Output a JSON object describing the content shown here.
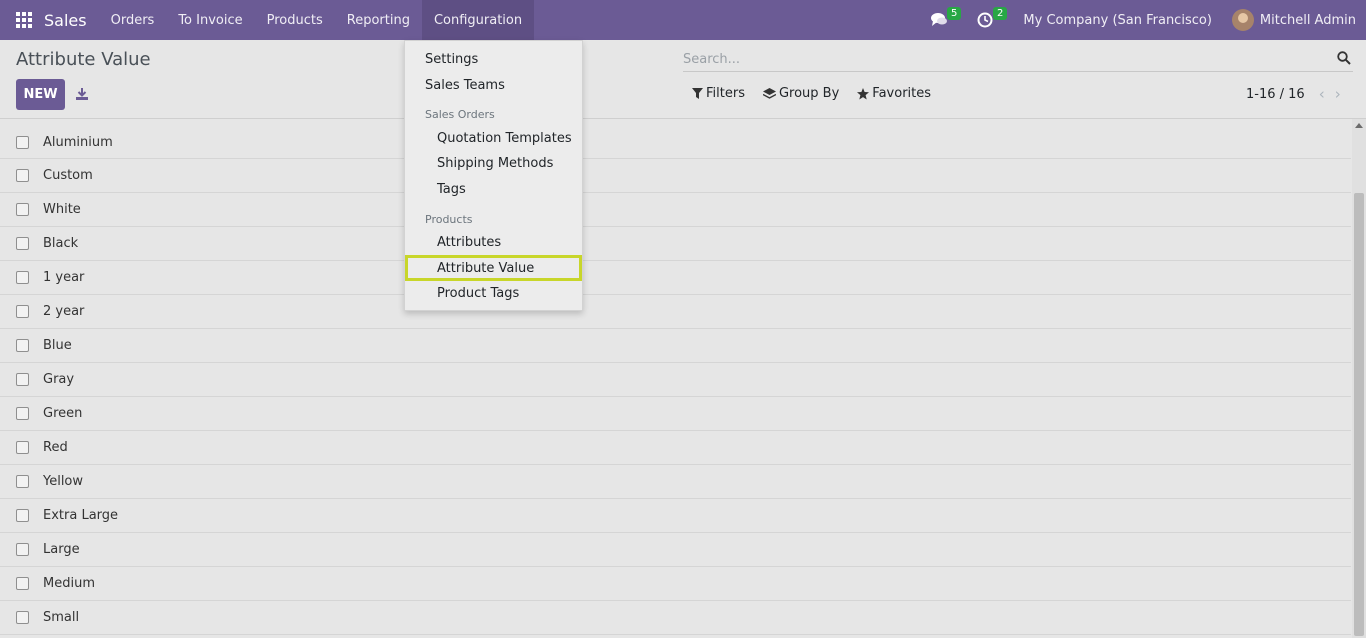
{
  "navbar": {
    "apps_icon": "apps-grid-icon",
    "brand": "Sales",
    "menu": [
      {
        "label": "Orders"
      },
      {
        "label": "To Invoice"
      },
      {
        "label": "Products"
      },
      {
        "label": "Reporting"
      },
      {
        "label": "Configuration"
      }
    ],
    "messages_badge": "5",
    "activities_badge": "2",
    "company": "My Company (San Francisco)",
    "user": "Mitchell Admin",
    "color": "#6b5b95"
  },
  "control": {
    "title": "Attribute Value",
    "new_label": "NEW",
    "search_placeholder": "Search...",
    "filters_label": "Filters",
    "groupby_label": "Group By",
    "favorites_label": "Favorites",
    "pager": "1-16 / 16"
  },
  "dropdown": {
    "items": [
      {
        "label": "Settings"
      },
      {
        "label": "Sales Teams"
      },
      {
        "header": "Sales Orders"
      },
      {
        "label": "Quotation Templates"
      },
      {
        "label": "Shipping Methods"
      },
      {
        "label": "Tags"
      },
      {
        "header": "Products"
      },
      {
        "label": "Attributes"
      },
      {
        "label": "Attribute Value"
      },
      {
        "label": "Product Tags"
      }
    ],
    "highlight_color": "#c8d62a"
  },
  "rows": [
    "Aluminium",
    "Custom",
    "White",
    "Black",
    "1 year",
    "2 year",
    "Blue",
    "Gray",
    "Green",
    "Red",
    "Yellow",
    "Extra Large",
    "Large",
    "Medium",
    "Small"
  ]
}
